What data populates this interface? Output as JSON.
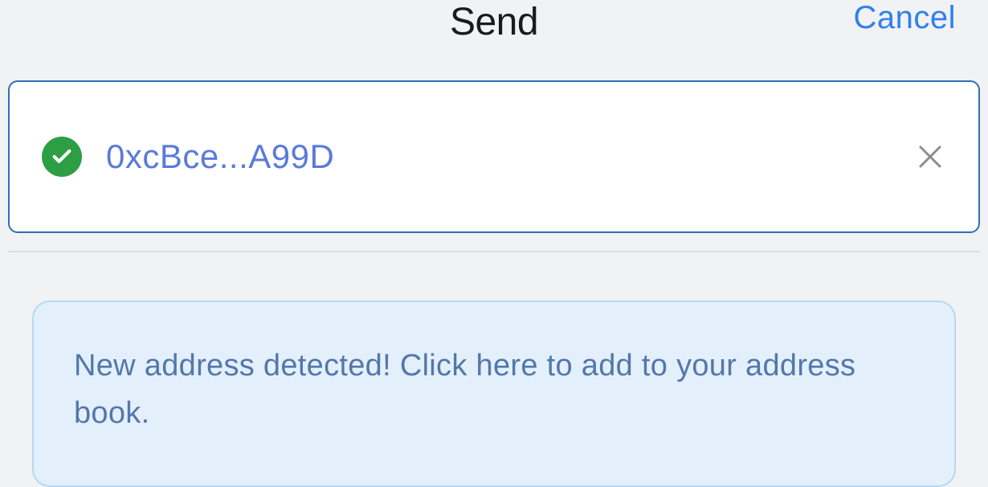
{
  "header": {
    "title": "Send",
    "cancel_label": "Cancel"
  },
  "address_input": {
    "value": "0xcBce...A99D",
    "verified": true
  },
  "notice": {
    "text": "New address detected! Click here to add to your address book."
  }
}
